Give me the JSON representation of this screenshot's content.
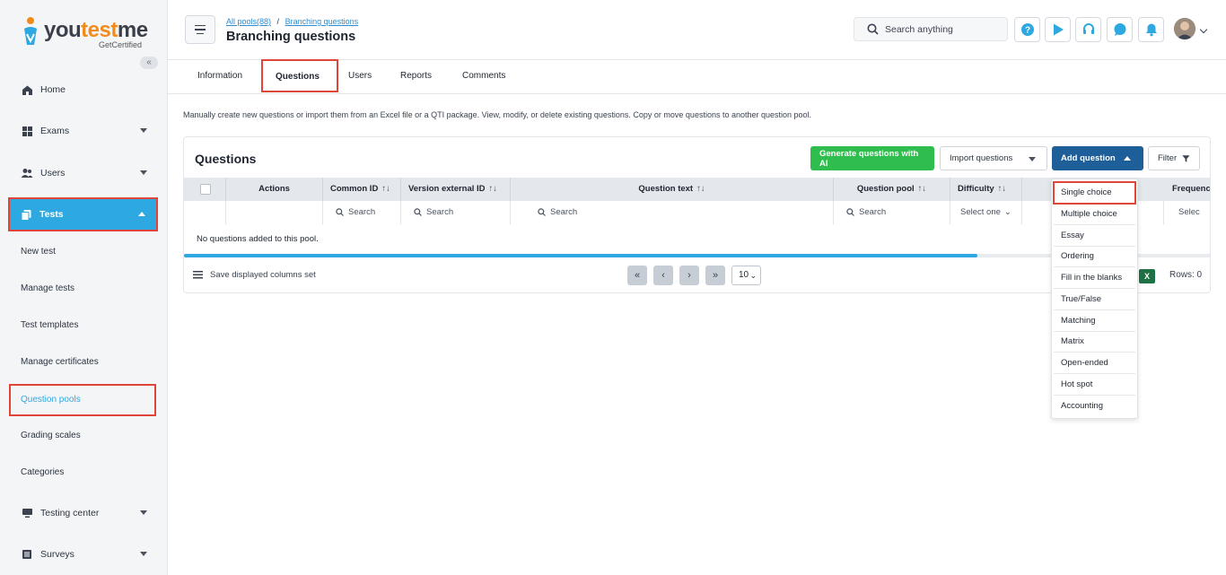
{
  "brand": {
    "name_a": "you",
    "name_b": "test",
    "name_c": "me",
    "tagline": "GetCertified",
    "colors": {
      "accent": "#2ea8e0",
      "orange": "#f28b1e",
      "highlight": "#e0453a"
    }
  },
  "sidebar": {
    "collapse_icon": "double-chevron-left-icon",
    "items": [
      {
        "label": "Home",
        "icon": "home-icon"
      },
      {
        "label": "Exams",
        "icon": "grid-icon"
      },
      {
        "label": "Users",
        "icon": "users-icon"
      },
      {
        "label": "Tests",
        "icon": "copy-icon"
      },
      {
        "label": "Testing center",
        "icon": "monitor-icon"
      },
      {
        "label": "Surveys",
        "icon": "list-icon"
      }
    ],
    "sub_items": [
      "New test",
      "Manage tests",
      "Test templates",
      "Manage certificates",
      "Question pools",
      "Grading scales",
      "Categories"
    ]
  },
  "header": {
    "crumb_root": "All pools(88)",
    "crumb_sep": "/",
    "crumb_current": "Branching questions",
    "title": "Branching questions",
    "search_placeholder": "Search anything"
  },
  "tabs": [
    "Information",
    "Questions",
    "Users",
    "Reports",
    "Comments"
  ],
  "description": "Manually create new questions or import them from an Excel file or a QTI package. View, modify, or delete existing questions. Copy or move questions to another question pool.",
  "questions": {
    "title": "Questions",
    "btn_ai": "Generate questions with AI",
    "btn_import": "Import questions",
    "btn_add": "Add question",
    "btn_filter": "Filter",
    "columns": [
      "Actions",
      "Common ID",
      "Version external ID",
      "Question text",
      "Question pool",
      "Difficulty",
      "Frequenc"
    ],
    "sort_glyph": "↑↓",
    "filter_search": "Search",
    "filter_select": "Select one",
    "filter_select_trunc": "Selec",
    "empty_text": "No questions added to this pool.",
    "save_columns": "Save displayed columns set",
    "page_size": "10",
    "rows_label": "Rows: 0",
    "excel_letter": "X"
  },
  "add_menu": [
    "Single choice",
    "Multiple choice",
    "Essay",
    "Ordering",
    "Fill in the blanks",
    "True/False",
    "Matching",
    "Matrix",
    "Open-ended",
    "Hot spot",
    "Accounting"
  ]
}
